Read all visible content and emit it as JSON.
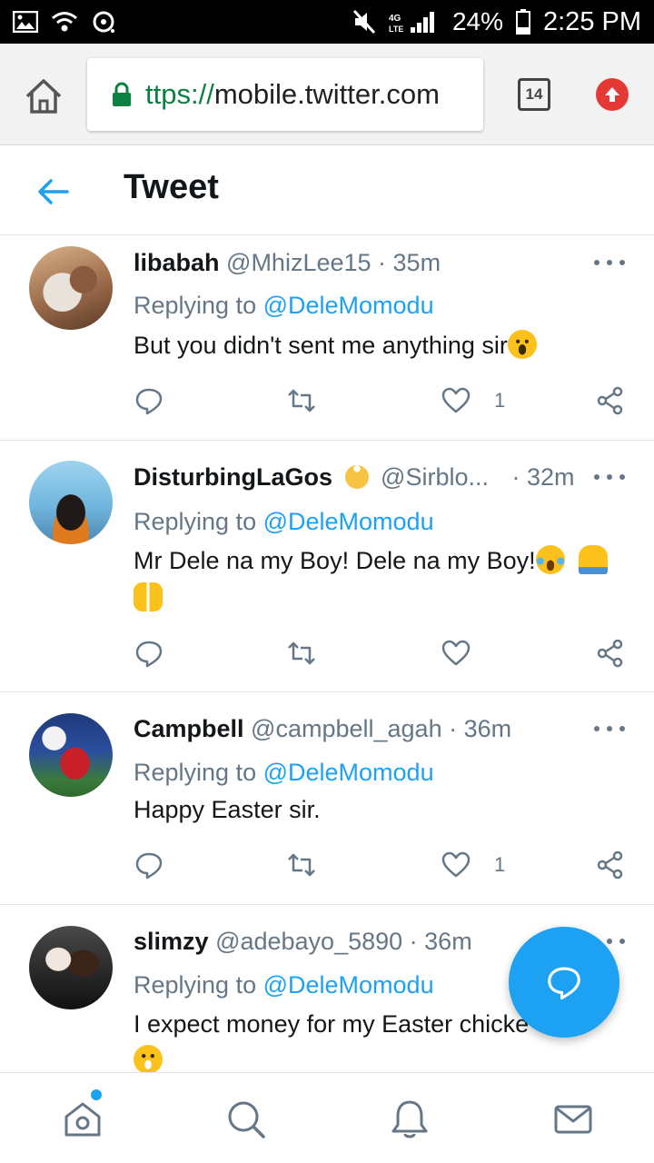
{
  "status_bar": {
    "battery": "24%",
    "time": "2:25 PM",
    "network": "4G LTE"
  },
  "browser": {
    "url_scheme": "ttps://",
    "url_host": "mobile.twitter.com",
    "tab_count": "14"
  },
  "header": {
    "title": "Tweet"
  },
  "tweets": [
    {
      "name": "libabah",
      "handle": "@MhizLee15",
      "time": "· 35m",
      "replying_prefix": "Replying to",
      "replying_to": "@DeleMomodu",
      "text": "But you didn't sent me anything sir",
      "like_count": "1"
    },
    {
      "name": "DisturbingLaGos",
      "handle": "@Sirblo...",
      "time": "· 32m",
      "replying_prefix": "Replying to",
      "replying_to": "@DeleMomodu",
      "text": "Mr Dele na my Boy! Dele na my Boy!",
      "like_count": ""
    },
    {
      "name": "Campbell",
      "handle": "@campbell_agah",
      "time": "· 36m",
      "replying_prefix": "Replying to",
      "replying_to": "@DeleMomodu",
      "text": "Happy Easter sir.",
      "like_count": "1"
    },
    {
      "name": "slimzy",
      "handle": "@adebayo_5890",
      "time": "· 36m",
      "replying_prefix": "Replying to",
      "replying_to": "@DeleMomodu",
      "text": "I expect money for my Easter chicke",
      "like_count": ""
    }
  ],
  "colors": {
    "accent": "#1da1f2",
    "text_primary": "#14171a",
    "text_secondary": "#657786"
  },
  "icons": {
    "back": "arrow-left-icon",
    "reply": "reply-icon",
    "retweet": "retweet-icon",
    "like": "heart-icon",
    "share": "share-icon",
    "compose": "compose-reply-icon",
    "nav": [
      "home-icon",
      "search-icon",
      "notifications-icon",
      "messages-icon"
    ]
  }
}
